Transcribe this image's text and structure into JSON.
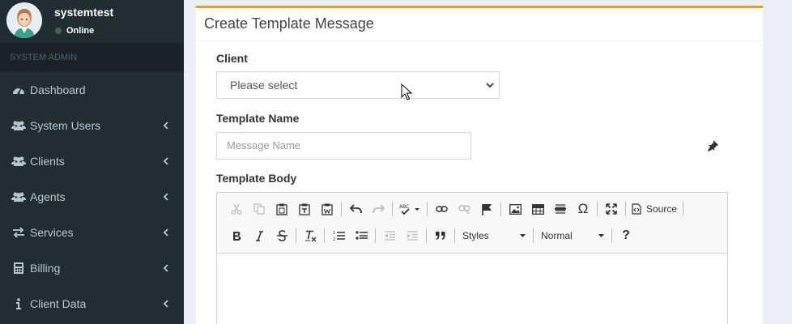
{
  "user": {
    "name": "systemtest",
    "status": "Online"
  },
  "sidebar": {
    "section": "SYSTEM ADMIN",
    "items": [
      {
        "label": "Dashboard",
        "icon": "dashboard-icon"
      },
      {
        "label": "System Users",
        "icon": "users-icon"
      },
      {
        "label": "Clients",
        "icon": "users-icon"
      },
      {
        "label": "Agents",
        "icon": "users-icon"
      },
      {
        "label": "Services",
        "icon": "exchange-icon"
      },
      {
        "label": "Billing",
        "icon": "calculator-icon"
      },
      {
        "label": "Client Data",
        "icon": "info-icon"
      }
    ]
  },
  "form": {
    "title": "Create Template Message",
    "client_label": "Client",
    "client_value": "Please select",
    "template_name_label": "Template Name",
    "template_name_placeholder": "Message Name",
    "template_body_label": "Template Body"
  },
  "editor": {
    "source_label": "Source",
    "styles_label": "Styles",
    "format_label": "Normal",
    "help_label": "?",
    "omega_label": "Ω"
  },
  "colors": {
    "sidebar_bg": "#222d32",
    "accent": "#f39c12",
    "sidebar_text": "#b8c7ce"
  }
}
